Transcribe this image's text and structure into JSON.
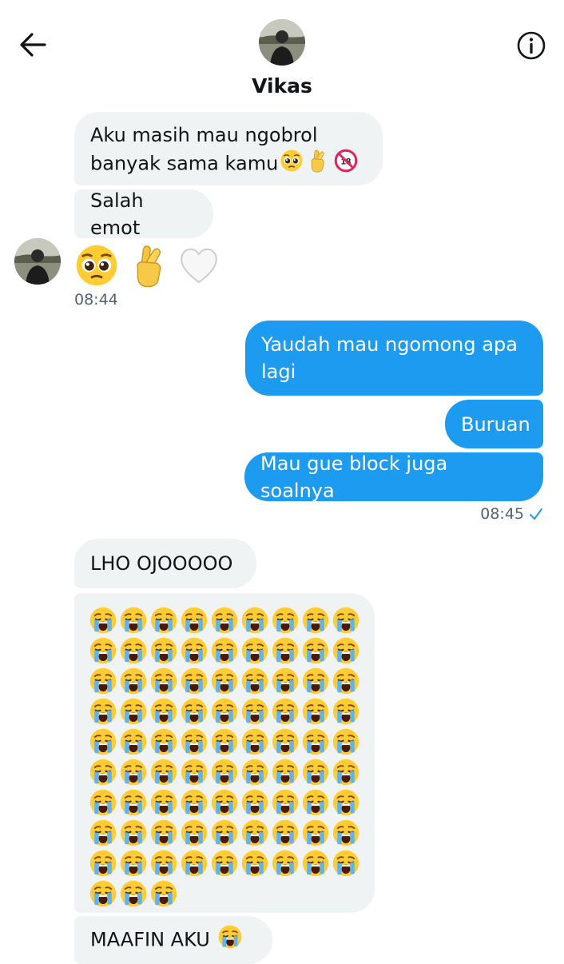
{
  "header": {
    "contact_name": "Vikas",
    "back_icon": "arrow-left-icon",
    "info_icon": "info-circle-icon"
  },
  "messages": [
    {
      "side": "received",
      "text": "Aku masih mau ngobrol banyak sama kamu",
      "emojis": [
        "pleading-face",
        "crossed-fingers",
        "no-under-18"
      ]
    },
    {
      "side": "received",
      "text": "Salah emot"
    },
    {
      "side": "received",
      "emojis": [
        "pleading-face",
        "crossed-fingers",
        "white-heart"
      ],
      "time": "08:44"
    },
    {
      "side": "sent",
      "text": "Yaudah mau ngomong apa lagi"
    },
    {
      "side": "sent",
      "text": "Buruan"
    },
    {
      "side": "sent",
      "text": "Mau gue block juga soalnya",
      "time": "08:45",
      "status_icon": "read-check-icon"
    },
    {
      "side": "received",
      "text": "LHO OJOOOOO"
    },
    {
      "side": "received",
      "emoji": "loudly-crying-face",
      "emoji_count": 84
    },
    {
      "side": "received",
      "text": "MAAFIN AKU",
      "emojis": [
        "loudly-crying-face"
      ]
    }
  ],
  "colors": {
    "sent_bubble": "#1d9bf0",
    "received_bubble": "#eff3f4",
    "timestamp": "#536471",
    "read_check": "#1d9bf0"
  }
}
